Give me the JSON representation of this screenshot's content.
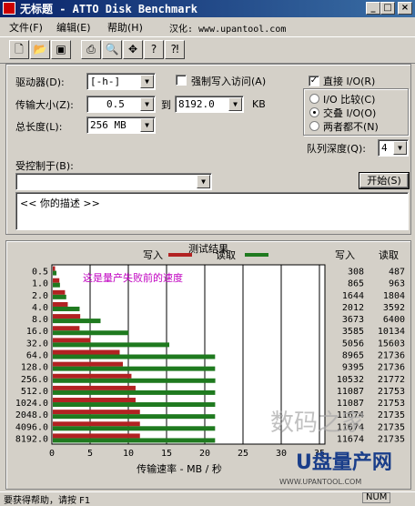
{
  "window": {
    "title": "无标题 - ATTO Disk Benchmark"
  },
  "menu": [
    "文件(F)",
    "编辑(E)",
    "帮助(H)",
    "汉化: www.upantool.com"
  ],
  "settings": {
    "drive_label": "驱动器(D):",
    "drive_value": "[-h-]",
    "force_write_label": "强制写入访问(A)",
    "direct_io_label": "直接 I/O(R)",
    "direct_io_checked": true,
    "transfer_label": "传输大小(Z):",
    "transfer_from": "0.5",
    "to_label": "到",
    "transfer_to": "8192.0",
    "kb_label": "KB",
    "total_label": "总长度(L):",
    "total_value": "256 MB",
    "io_options": [
      "I/O 比较(C)",
      "交叠 I/O(O)",
      "两者都不(N)"
    ],
    "io_selected": 1,
    "queue_label": "队列深度(Q):",
    "queue_value": "4",
    "controlled_label": "受控制于(B):",
    "controlled_value": "",
    "start_button": "开始(S)",
    "description": "<< 你的描述 >>"
  },
  "colors": {
    "write": "#b22222",
    "read": "#1f7a1f"
  },
  "annotation": "这是量产失败前的速度",
  "watermark": [
    "数码之家",
    "U盘量产网",
    "WWW.UPANTOOL.COM"
  ],
  "status": {
    "left": "要获得帮助，请按 F1",
    "right": "NUM"
  },
  "chart_data": {
    "type": "bar",
    "orientation": "horizontal",
    "title": "测试结果",
    "legend": [
      {
        "name": "写入",
        "color": "#b22222"
      },
      {
        "name": "读取",
        "color": "#1f7a1f"
      }
    ],
    "xlabel": "传输速率 - MB / 秒",
    "xlim": [
      0,
      50
    ],
    "xticks": [
      "0",
      "5",
      "10",
      "15",
      "20",
      "25",
      "30",
      "35"
    ],
    "categories": [
      "0.5",
      "1.0",
      "2.0",
      "4.0",
      "8.0",
      "16.0",
      "32.0",
      "64.0",
      "128.0",
      "256.0",
      "512.0",
      "1024.0",
      "2048.0",
      "4096.0",
      "8192.0"
    ],
    "series": [
      {
        "name": "写入",
        "values": [
          0.3,
          0.86,
          1.6,
          1.96,
          3.59,
          3.5,
          4.94,
          8.75,
          9.17,
          10.29,
          10.83,
          10.83,
          11.4,
          11.4,
          11.4
        ]
      },
      {
        "name": "读取",
        "values": [
          0.48,
          0.94,
          1.76,
          3.51,
          6.25,
          9.9,
          15.24,
          21.23,
          21.23,
          21.26,
          21.24,
          21.24,
          21.23,
          21.23,
          21.23
        ]
      }
    ],
    "table_headers": [
      "写入",
      "读取"
    ],
    "write_kb": [
      "308",
      "865",
      "1644",
      "2012",
      "3673",
      "3585",
      "5056",
      "8965",
      "9395",
      "10532",
      "11087",
      "11087",
      "11674",
      "11674",
      "11674"
    ],
    "read_kb": [
      "487",
      "963",
      "1804",
      "3592",
      "6400",
      "10134",
      "15603",
      "21736",
      "21736",
      "21772",
      "21753",
      "21753",
      "21735",
      "21735",
      "21735"
    ]
  }
}
